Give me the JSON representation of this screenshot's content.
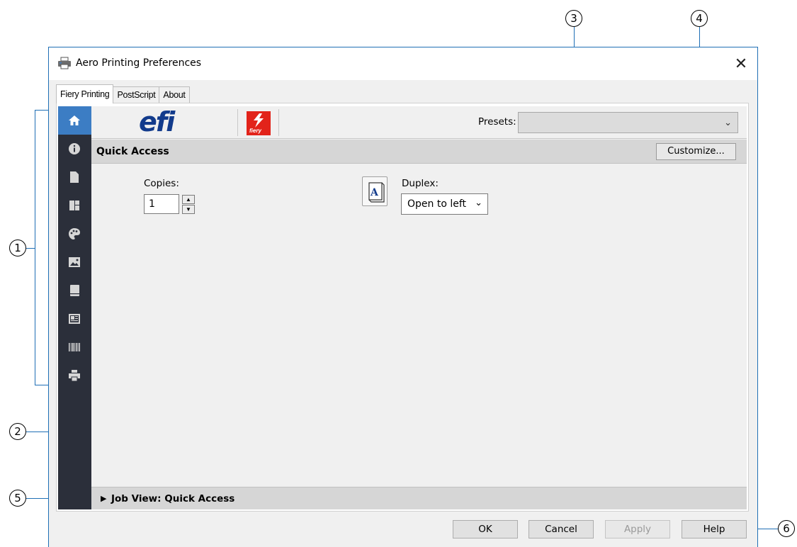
{
  "callouts": [
    "1",
    "2",
    "3",
    "4",
    "5",
    "6"
  ],
  "window": {
    "title": "Aero Printing Preferences",
    "close_glyph": "✕"
  },
  "tabs": [
    {
      "label": "Fiery Printing",
      "active": true
    },
    {
      "label": "PostScript",
      "active": false
    },
    {
      "label": "About",
      "active": false
    }
  ],
  "sidebar": {
    "items": [
      {
        "icon": "home-icon",
        "active": true
      },
      {
        "icon": "info-icon",
        "active": false
      },
      {
        "icon": "document-icon",
        "active": false
      },
      {
        "icon": "layout-icon",
        "active": false
      },
      {
        "icon": "palette-icon",
        "active": false
      },
      {
        "icon": "image-icon",
        "active": false
      },
      {
        "icon": "book-icon",
        "active": false
      },
      {
        "icon": "stamp-icon",
        "active": false
      },
      {
        "icon": "barcode-icon",
        "active": false
      },
      {
        "icon": "printer-icon",
        "active": false
      }
    ]
  },
  "header": {
    "efi_logo": "efi",
    "fiery_logo": "fiery",
    "presets_label": "Presets:",
    "presets_value": ""
  },
  "quick_access": {
    "title": "Quick Access",
    "customize_label": "Customize...",
    "copies_label": "Copies:",
    "copies_value": "1",
    "duplex_label": "Duplex:",
    "duplex_value": "Open to left",
    "duplex_icon_text": "A"
  },
  "job_view": {
    "label": "Job View: Quick Access"
  },
  "buttons": {
    "ok": "OK",
    "cancel": "Cancel",
    "apply": "Apply",
    "help": "Help"
  },
  "colors": {
    "sidebar_bg": "#2b2f3a",
    "sidebar_active": "#3c7dc4",
    "callout_line": "#1f6fb5",
    "efi_blue": "#123b8c",
    "fiery_red": "#e2231a"
  }
}
